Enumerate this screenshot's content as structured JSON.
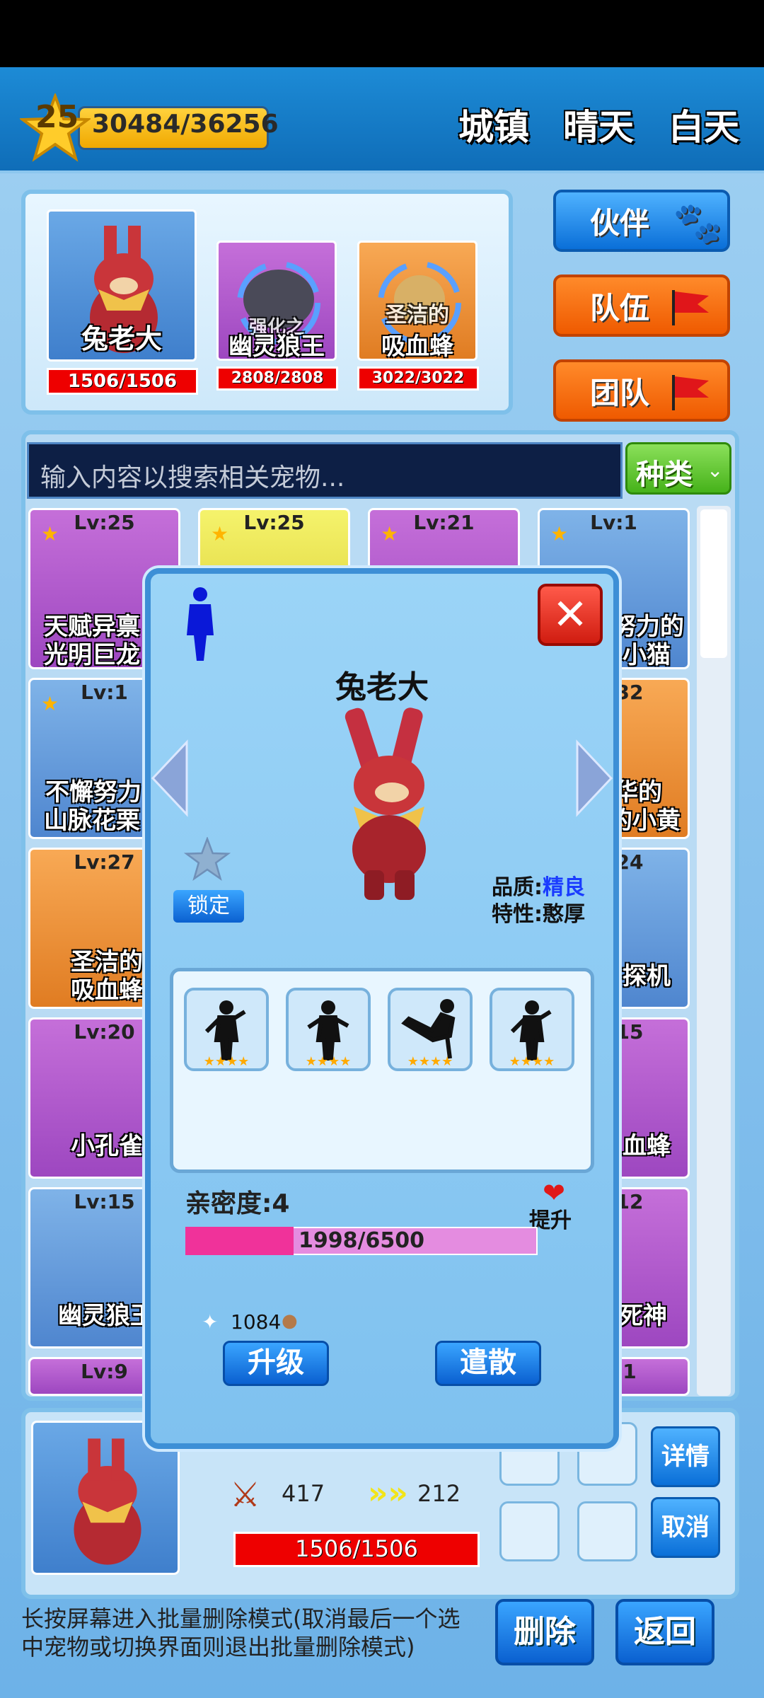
{
  "header": {
    "level": "25",
    "exp": "30484/36256",
    "location": "城镇",
    "weather": "晴天",
    "time": "白天"
  },
  "team": [
    {
      "name": "兔老大",
      "hp": "1506/1506"
    },
    {
      "name": "幽灵狼王",
      "prefix": "强化之",
      "hp": "2808/2808"
    },
    {
      "name": "吸血蜂",
      "prefix": "圣洁的",
      "hp": "3022/3022"
    }
  ],
  "side_buttons": {
    "partner": "伙伴",
    "squad": "队伍",
    "group": "团队"
  },
  "search": {
    "placeholder": "输入内容以搜索相关宠物...",
    "filter": "种类"
  },
  "cards": [
    {
      "lv": "Lv:25",
      "name": "天赋异禀",
      "name2": "光明巨龙"
    },
    {
      "lv": "Lv:25"
    },
    {
      "lv": "Lv:21"
    },
    {
      "lv": "Lv:1",
      "name": "努力的",
      "name2": "小猫"
    },
    {
      "lv": "Lv:1",
      "name": "不懈努力",
      "name2": "山脉花栗"
    },
    {
      "lv": "32",
      "name": "华的",
      "name2": "的小黄"
    },
    {
      "lv": "Lv:27",
      "name": "圣洁的",
      "name2": "吸血蜂"
    },
    {
      "lv": "24",
      "name": "探机"
    },
    {
      "lv": "Lv:20",
      "name": "小孔雀"
    },
    {
      "lv": "15",
      "name": "血蜂"
    },
    {
      "lv": "Lv:15",
      "name": "幽灵狼王"
    },
    {
      "lv": "12",
      "name": "死神"
    },
    {
      "lv": "Lv:9"
    },
    {
      "lv": "1"
    }
  ],
  "modal": {
    "pet_name": "兔老大",
    "lock": "锁定",
    "quality_label": "品质:",
    "quality_value": "精良",
    "trait_label": "特性:",
    "trait_value": "憨厚",
    "intimacy": "亲密度:4",
    "intimacy_up": "提升",
    "intimacy_bar": "1998/6500",
    "intimacy_progress": 0.307,
    "cost": "1084",
    "upgrade": "升级",
    "dismiss": "遣散"
  },
  "bottom": {
    "attack": "417",
    "speed": "212",
    "hp": "1506/1506",
    "details": "详情",
    "cancel": "取消",
    "hint": "长按屏幕进入批量删除模式(取消最后一个选中宠物或切换界面则退出批量删除模式)",
    "delete": "删除",
    "back": "返回"
  },
  "colors": {
    "hp_red": "#ee0000",
    "intimacy_pink": "#f0329a",
    "accent_blue": "#0a6fd8",
    "accent_orange": "#ef5a00"
  }
}
